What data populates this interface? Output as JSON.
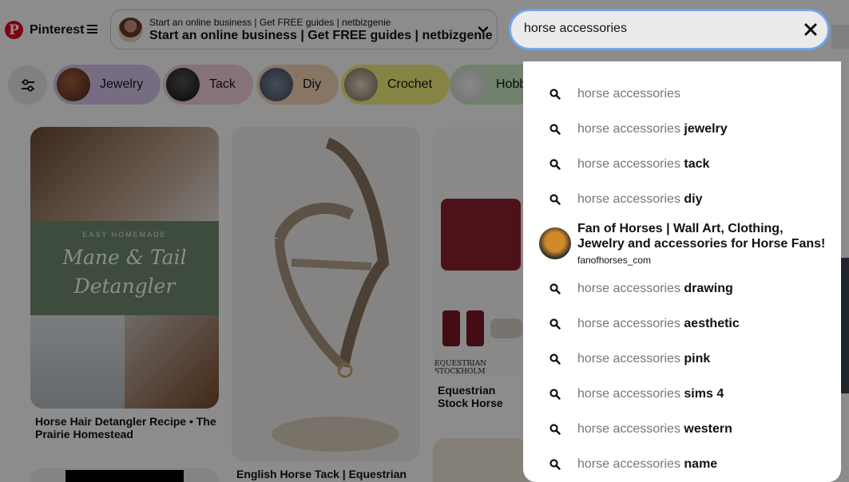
{
  "app": {
    "name": "Pinterest"
  },
  "ad": {
    "line1": "Start an online business | Get FREE guides | netbizgenie",
    "line2": "Start an online business | Get FREE guides | netbizgenie"
  },
  "search": {
    "value": "horse accessories"
  },
  "chips": [
    {
      "label": "Jewelry",
      "color": "#d9c6ef"
    },
    {
      "label": "Tack",
      "color": "#f4d0dc"
    },
    {
      "label": "Diy",
      "color": "#f7d8b6"
    },
    {
      "label": "Crochet",
      "color": "#f5f07e"
    },
    {
      "label": "Hobb",
      "color": "#cdebc5"
    }
  ],
  "pins": [
    {
      "title": "Horse Hair Detangler Recipe • The Prairie Homestead",
      "overlay_text": "EASY HOMEMADE",
      "overlay_title": "Mane & Tail Detangler"
    },
    {
      "title": "English Horse Tack | Equestrian"
    },
    {
      "title": "Equestrian Stock Horse",
      "brand": "EQUESTRIAN STOCKHOLM"
    }
  ],
  "dropdown": {
    "suggestions_top": [
      {
        "base": "horse accessories",
        "suffix": ""
      },
      {
        "base": "horse accessories",
        "suffix": "jewelry"
      },
      {
        "base": "horse accessories",
        "suffix": "tack"
      },
      {
        "base": "horse accessories",
        "suffix": "diy"
      }
    ],
    "profile": {
      "name": "Fan of Horses | Wall Art, Clothing, Jewelry and accessories for Horse Fans!",
      "handle": "fanofhorses_com"
    },
    "suggestions_bottom": [
      {
        "base": "horse accessories",
        "suffix": "drawing"
      },
      {
        "base": "horse accessories",
        "suffix": "aesthetic"
      },
      {
        "base": "horse accessories",
        "suffix": "pink"
      },
      {
        "base": "horse accessories",
        "suffix": "sims 4"
      },
      {
        "base": "horse accessories",
        "suffix": "western"
      },
      {
        "base": "horse accessories",
        "suffix": "name"
      }
    ]
  },
  "colors": {
    "brand": "#e60023",
    "focus": "#74a4f0"
  }
}
